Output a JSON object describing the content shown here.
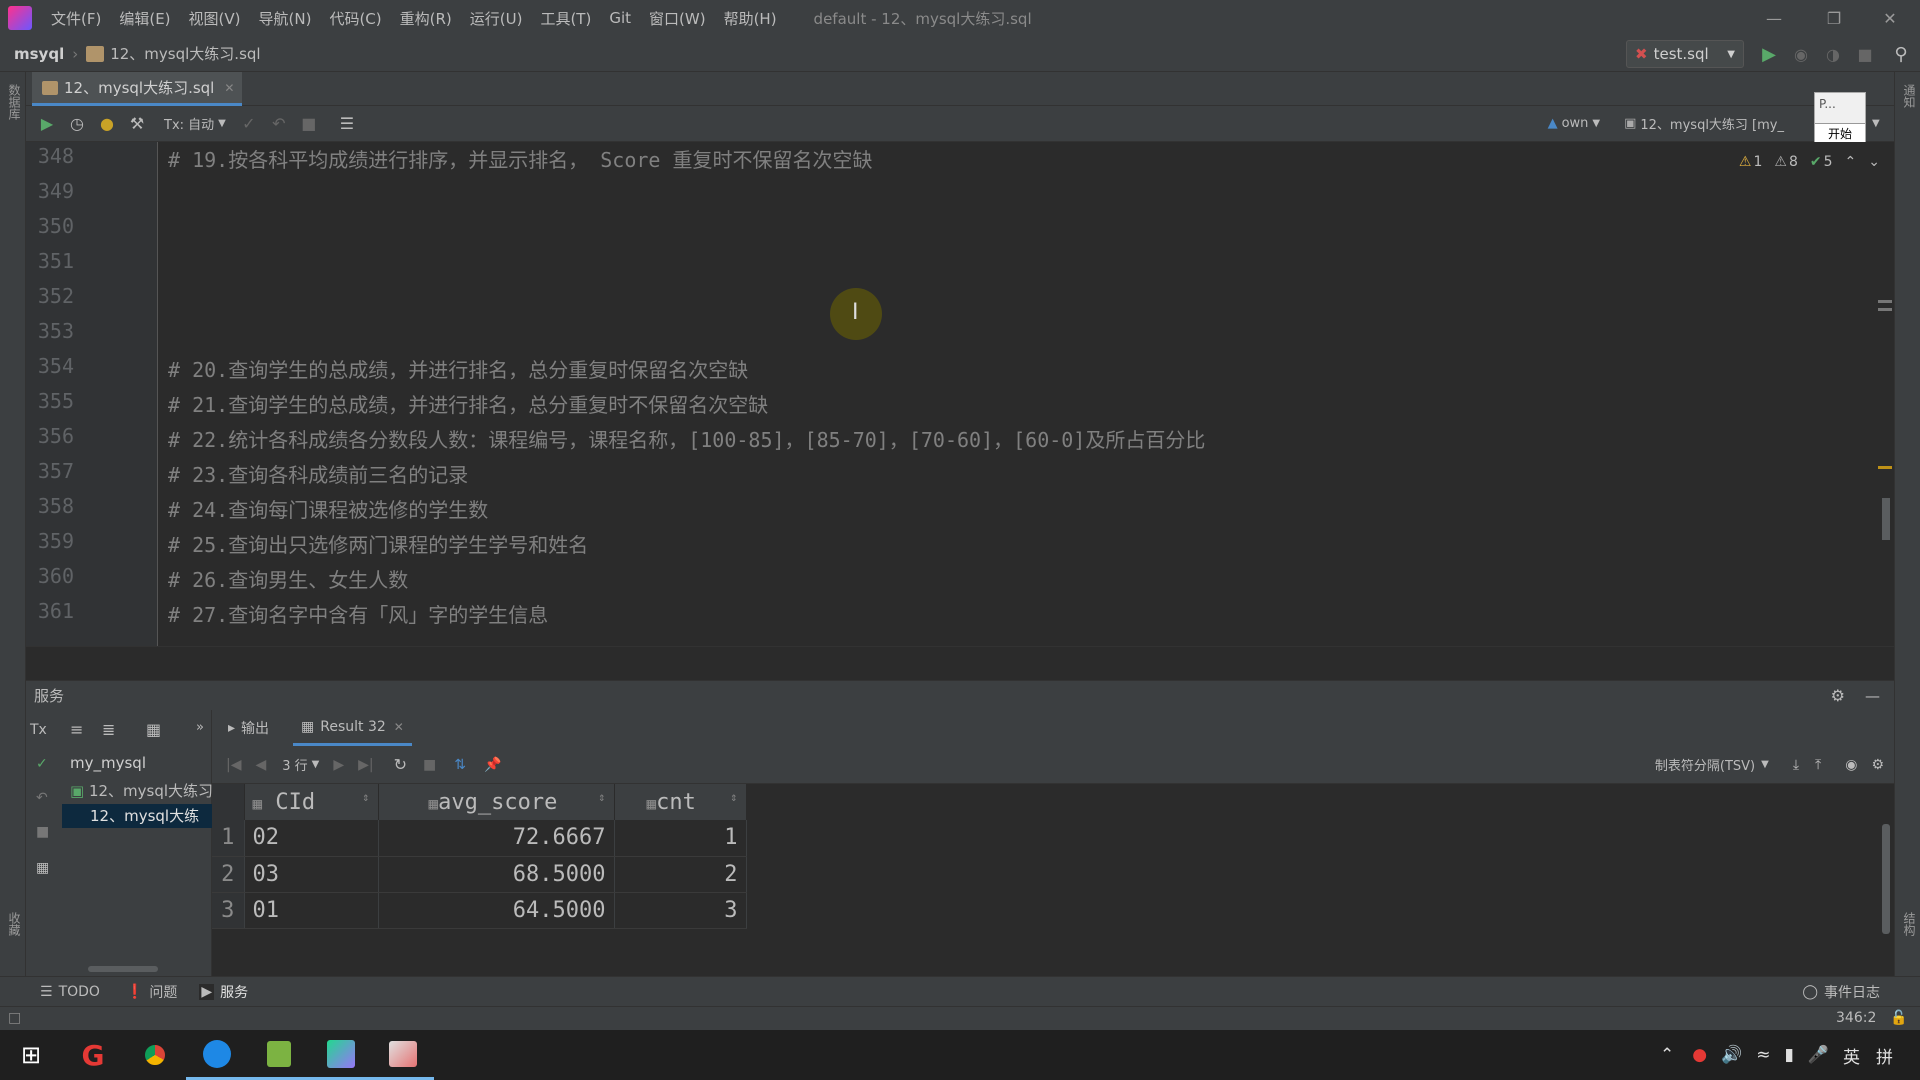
{
  "menubar": {
    "items": [
      "文件(F)",
      "编辑(E)",
      "视图(V)",
      "导航(N)",
      "代码(C)",
      "重构(R)",
      "运行(U)",
      "工具(T)",
      "Git",
      "窗口(W)",
      "帮助(H)"
    ],
    "window_title": "default - 12、mysql大练习.sql"
  },
  "navbar": {
    "project": "msyql",
    "file": "12、mysql大练习.sql",
    "run_config": "test.sql"
  },
  "editor_tab": {
    "label": "12、mysql大练习.sql"
  },
  "editor_toolbar": {
    "tx_label": "Tx: 自动",
    "schema_label": "own",
    "session_label": "12、mysql大练习 [my_",
    "popup_text": "P...",
    "popup_button": "开始"
  },
  "inspections": {
    "warnings": "1",
    "weak_warnings": "8",
    "ok": "5"
  },
  "code": {
    "lines": [
      {
        "no": "348",
        "text": "# 19.按各科平均成绩进行排序，并显示排名， Score 重复时不保留名次空缺"
      },
      {
        "no": "349",
        "text": ""
      },
      {
        "no": "350",
        "text": ""
      },
      {
        "no": "351",
        "text": ""
      },
      {
        "no": "352",
        "text": ""
      },
      {
        "no": "353",
        "text": ""
      },
      {
        "no": "354",
        "text": "# 20.查询学生的总成绩，并进行排名，总分重复时保留名次空缺"
      },
      {
        "no": "355",
        "text": "# 21.查询学生的总成绩，并进行排名，总分重复时不保留名次空缺"
      },
      {
        "no": "356",
        "text": "# 22.统计各科成绩各分数段人数：课程编号，课程名称，[100-85]，[85-70]，[70-60]，[60-0]及所占百分比"
      },
      {
        "no": "357",
        "text": "# 23.查询各科成绩前三名的记录"
      },
      {
        "no": "358",
        "text": "# 24.查询每门课程被选修的学生数"
      },
      {
        "no": "359",
        "text": "# 25.查询出只选修两门课程的学生学号和姓名"
      },
      {
        "no": "360",
        "text": "# 26.查询男生、女生人数"
      },
      {
        "no": "361",
        "text": "# 27.查询名字中含有「风」字的学生信息"
      }
    ]
  },
  "services": {
    "title": "服务",
    "tree": [
      "my_mysql",
      "12、mysql大练习",
      "12、mysql大练"
    ],
    "tabs": [
      "输出",
      "Result 32"
    ],
    "rows_label": "3 行",
    "export_label": "制表符分隔(TSV)",
    "columns": [
      "CId",
      "avg_score",
      "cnt"
    ],
    "rows": [
      {
        "n": "1",
        "cid": "02",
        "avg": "72.6667",
        "cnt": "1"
      },
      {
        "n": "2",
        "cid": "03",
        "avg": "68.5000",
        "cnt": "2"
      },
      {
        "n": "3",
        "cid": "01",
        "avg": "64.5000",
        "cnt": "3"
      }
    ]
  },
  "toolwindows": [
    "TODO",
    "问题",
    "服务"
  ],
  "event_log": "事件日志",
  "status": {
    "position": "346:2"
  },
  "taskbar": {
    "ime": "英",
    "ime2": "拼"
  },
  "colors": {
    "accent": "#4a88c7",
    "comment": "#808080"
  }
}
